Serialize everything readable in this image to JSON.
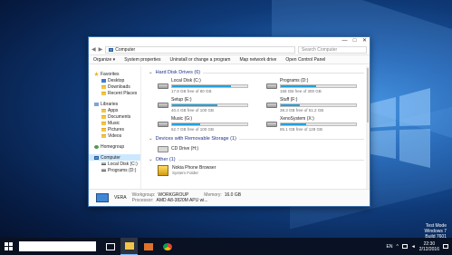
{
  "watermark": {
    "line1": "Test Mode",
    "line2": "Windows 7",
    "line3": "Build 7601"
  },
  "window": {
    "title": "",
    "address": "Computer",
    "search_placeholder": "Search Computer",
    "controls": {
      "min": "—",
      "max": "□",
      "close": "✕"
    }
  },
  "command_bar": {
    "organize": "Organize ▾",
    "system_properties": "System properties",
    "uninstall": "Uninstall or change a program",
    "map_drive": "Map network drive",
    "control_panel": "Open Control Panel"
  },
  "nav": {
    "favorites": "Favorites",
    "desktop": "Desktop",
    "downloads": "Downloads",
    "recent": "Recent Places",
    "libraries": "Libraries",
    "apps": "Apps",
    "documents": "Documents",
    "music": "Music",
    "pictures": "Pictures",
    "videos": "Videos",
    "homegroup": "Homegroup",
    "computer": "Computer",
    "local_disk": "Local Disk (C:)",
    "programs": "Programs (D:)"
  },
  "sections": {
    "hdd": "Hard Disk Drives (6)",
    "removable": "Devices with Removable Storage (1)",
    "other": "Other (1)"
  },
  "drives": [
    {
      "name": "Local Disk (C:)",
      "free": "17.8 GB free of 80 GB",
      "used_pct": 78
    },
    {
      "name": "Programs (D:)",
      "free": "158 GB free of 300 GB",
      "used_pct": 47
    },
    {
      "name": "Setup (E:)",
      "free": "40.4 GB free of 100 GB",
      "used_pct": 60
    },
    {
      "name": "Stuff (F:)",
      "free": "38.3 GB free of 51.2 GB",
      "used_pct": 25
    },
    {
      "name": "Music (G:)",
      "free": "62.7 GB free of 100 GB",
      "used_pct": 37
    },
    {
      "name": "XenoSystem (X:)",
      "free": "85.1 GB free of 128 GB",
      "used_pct": 34
    }
  ],
  "cd_drive": {
    "name": "CD Drive (H:)"
  },
  "other_item": {
    "name": "Nokia Phone Browser",
    "type": "System Folder"
  },
  "details": {
    "name": "VERA",
    "workgroup_label": "Workgroup:",
    "workgroup_value": "WORKGROUP",
    "memory_label": "Memory:",
    "memory_value": "16.0 GB",
    "processor_label": "Processor:",
    "processor_value": "AMD A8-3820M APU wi..."
  },
  "taskbar": {
    "lang": "EN",
    "time": "22:30",
    "date": "2/12/2016"
  },
  "colors": {
    "accent": "#26a0da",
    "section": "#1e3287"
  }
}
